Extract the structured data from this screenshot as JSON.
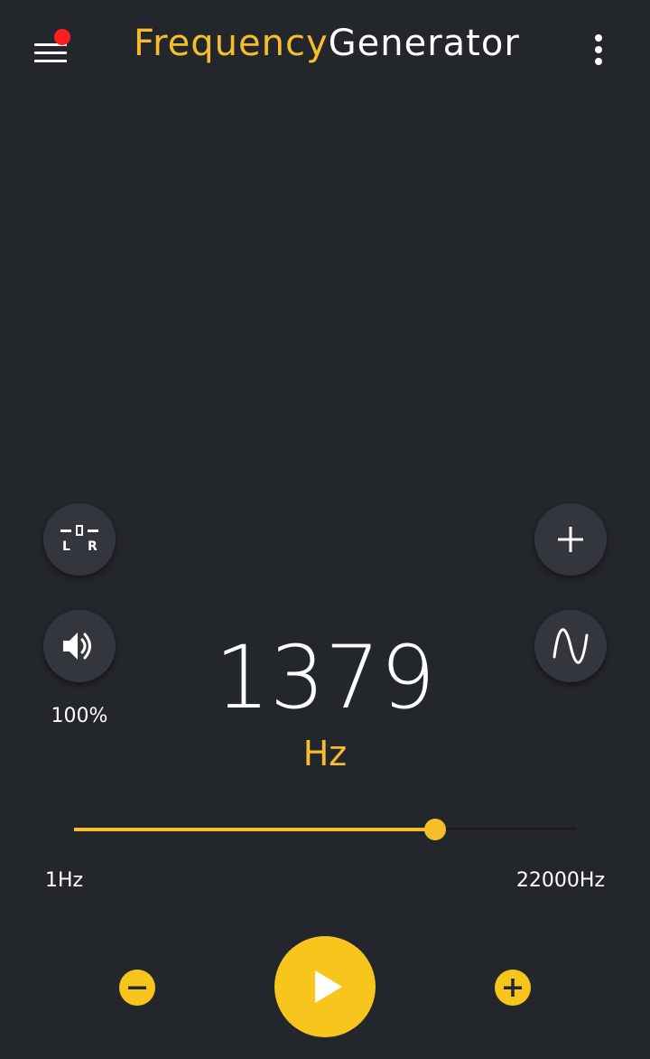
{
  "app": {
    "title_part1": "Frequency",
    "title_part2": "Generator",
    "accent_color": "#f5be2a",
    "background_color": "#23262b",
    "notification_dot_color": "#ff1f1f"
  },
  "toolbar": {
    "menu_icon": "hamburger-menu-icon",
    "has_notification_dot": true,
    "overflow_icon": "more-vert-icon"
  },
  "controls": {
    "balance_button": {
      "icon": "balance-lr-icon",
      "left_label": "L",
      "right_label": "R"
    },
    "volume_button": {
      "icon": "speaker-icon",
      "percent_label": "100%"
    },
    "add_button": {
      "icon": "plus-icon"
    },
    "waveform_button": {
      "icon": "sine-wave-icon"
    }
  },
  "frequency": {
    "value": "1379",
    "unit": "Hz"
  },
  "slider": {
    "min_label": "1Hz",
    "max_label": "22000Hz",
    "position_fraction": 0.72
  },
  "bottom_bar": {
    "decrease_icon": "minus-circle-icon",
    "play_icon": "play-icon",
    "increase_icon": "plus-circle-icon"
  }
}
